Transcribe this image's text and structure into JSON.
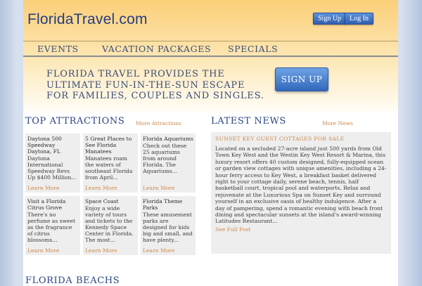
{
  "header": {
    "logo": "FloridaTravel.com",
    "sign_up_label": "Sign Up",
    "log_in_label": "Log In"
  },
  "nav": {
    "items": [
      {
        "label": "EVENTS"
      },
      {
        "label": "VACATION PACKAGES"
      },
      {
        "label": "SPECIALS"
      }
    ]
  },
  "hero": {
    "tagline": "FLORIDA TRAVEL PROVIDES THE ULTIMATE FUN-IN-THE-SUN ESCAPE FOR FAMILIES, COUPLES AND SINGLES.",
    "cta_label": "SIGN UP"
  },
  "attractions": {
    "title": "TOP ATTRACTIONS",
    "more_label": "More Attractions",
    "cards": [
      {
        "title": "Daytona 500 Speedway Daytona, FL",
        "body": "Daytona International Speedway Revs Up $400 Million...",
        "link": "Learn More"
      },
      {
        "title": "5 Great Places to See Florida Manatees",
        "body": "Manatees roam the waters of southeast Florida from April...",
        "link": "Learn More"
      },
      {
        "title": "Florida Aquariums",
        "body": "Check out these 25 aquariums from around Florida. The Aquariums...",
        "link": "Learn More"
      },
      {
        "title": "Visit a Florida Citrus Grove",
        "body": "There's no perfume as sweet as the fragrance of citrus blossoms...",
        "link": "Learn More"
      },
      {
        "title": "Space Coast",
        "body": "Enjoy a wide variety of tours and tickets to the Kennedy Space Center in Florida. The most...",
        "link": "Learn More"
      },
      {
        "title": "Florida Theme Parks",
        "body": "These amusement parks are designed for kids big and small, and have plenty...",
        "link": "Learn More"
      }
    ]
  },
  "news": {
    "title": "LATEST NEWS",
    "more_label": "More News",
    "item_title": "SUNSET KEY GUEST COTTAGES FOR SALE",
    "item_body": "Located on a secluded 27-acre island just 500 yards from Old Town Key West and the Westin Key West Resort & Marina, this luxury resort offers 40 custom designed, fully-equipped ocean or garden view cottages with unique amenities, including a 24-hour ferry access to Key West, a breakfast basket delivered right to your cottage daily, serene beach, tennis, half basketball court, tropical pool and waterports. Relax and rejuvenate at the Luxurious Spa on Sunset Key and surround yourself in an exclusive oasis of healthy indulgence. After a day of pampering, spend a romantic evening with beach front dining and spectacular sunsets at the island's award-winning Latitudes Restaurant...",
    "item_link": "See Full Post"
  },
  "beaches": {
    "title": "FLORIDA BEACHS"
  }
}
